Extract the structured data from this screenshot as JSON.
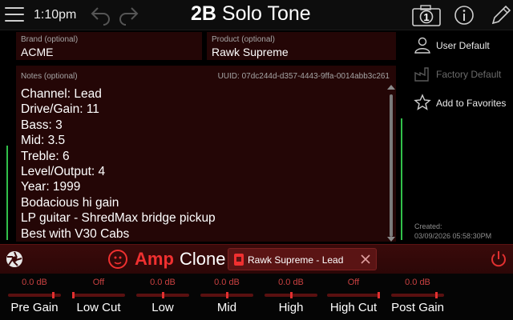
{
  "header": {
    "time": "1:10pm",
    "title_bold": "2B",
    "title_rest": " Solo Tone",
    "camera_badge": "1"
  },
  "tone": {
    "brand_label": "Brand (optional)",
    "brand_value": "ACME",
    "product_label": "Product (optional)",
    "product_value": "Rawk Supreme",
    "notes_label": "Notes (optional)",
    "uuid": "UUID: 07dc244d-d357-4443-9ffa-0014abb3c261",
    "notes": "Channel: Lead\nDrive/Gain: 11\nBass: 3\nMid: 3.5\nTreble: 6\nLevel/Output: 4\nYear: 1999\nBodacious hi gain\nLP guitar - ShredMax bridge pickup\nBest with V30 Cabs"
  },
  "sidebar": {
    "user_default": "User Default",
    "factory_default": "Factory Default",
    "add_favorites": "Add to Favorites",
    "created_label": "Created:",
    "created_value": "03/09/2026 05:58:30PM"
  },
  "ampbar": {
    "amp_word": "Amp",
    "clone_word": "Clone",
    "preset_name": "Rawk Supreme - Lead"
  },
  "params": [
    {
      "name": "Pre Gain",
      "value": "0.0 dB",
      "level": 0.88
    },
    {
      "name": "Low Cut",
      "value": "Off",
      "level": 0.0
    },
    {
      "name": "Low",
      "value": "0.0 dB",
      "level": 0.5
    },
    {
      "name": "Mid",
      "value": "0.0 dB",
      "level": 0.5
    },
    {
      "name": "High",
      "value": "0.0 dB",
      "level": 0.5
    },
    {
      "name": "High Cut",
      "value": "Off",
      "level": 1.0
    },
    {
      "name": "Post Gain",
      "value": "0.0 dB",
      "level": 0.88
    }
  ],
  "colors": {
    "accent_red": "#f03030",
    "meter_green": "#31c04a"
  }
}
